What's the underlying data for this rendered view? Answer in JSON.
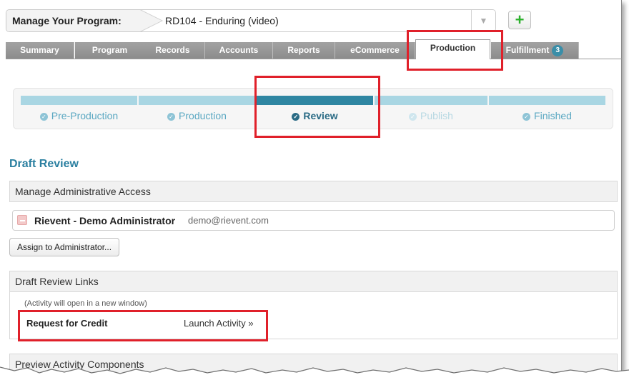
{
  "program": {
    "label": "Manage Your Program:",
    "selected": "RD104 - Enduring (video)",
    "add_icon": "plus-icon"
  },
  "tabs": [
    {
      "label": "Summary"
    },
    {
      "label": "Program"
    },
    {
      "label": "Records"
    },
    {
      "label": "Accounts"
    },
    {
      "label": "Reports"
    },
    {
      "label": "eCommerce"
    },
    {
      "label": "Production"
    },
    {
      "label": "Fulfillment",
      "badge": "3"
    }
  ],
  "active_tab": "Production",
  "steps": [
    {
      "label": "Pre-Production",
      "state": "complete"
    },
    {
      "label": "Production",
      "state": "complete"
    },
    {
      "label": "Review",
      "state": "current"
    },
    {
      "label": "Publish",
      "state": "future"
    },
    {
      "label": "Finished",
      "state": "complete"
    }
  ],
  "section_title": "Draft Review",
  "admin_access": {
    "heading": "Manage Administrative Access",
    "admin_name": "Rievent - Demo Administrator",
    "admin_email": "demo@rievent.com",
    "assign_button": "Assign to Administrator..."
  },
  "review_links": {
    "heading": "Draft Review Links",
    "note": "(Activity will open in a new window)",
    "activity_name": "Request for Credit",
    "launch_label": "Launch Activity »"
  },
  "preview_heading": "Preview Activity Components",
  "colors": {
    "accent": "#2a7fa0",
    "step_done": "#a9d6e3",
    "step_current": "#2f86a2",
    "highlight": "#e0202a",
    "add_green": "#2bb02b"
  }
}
